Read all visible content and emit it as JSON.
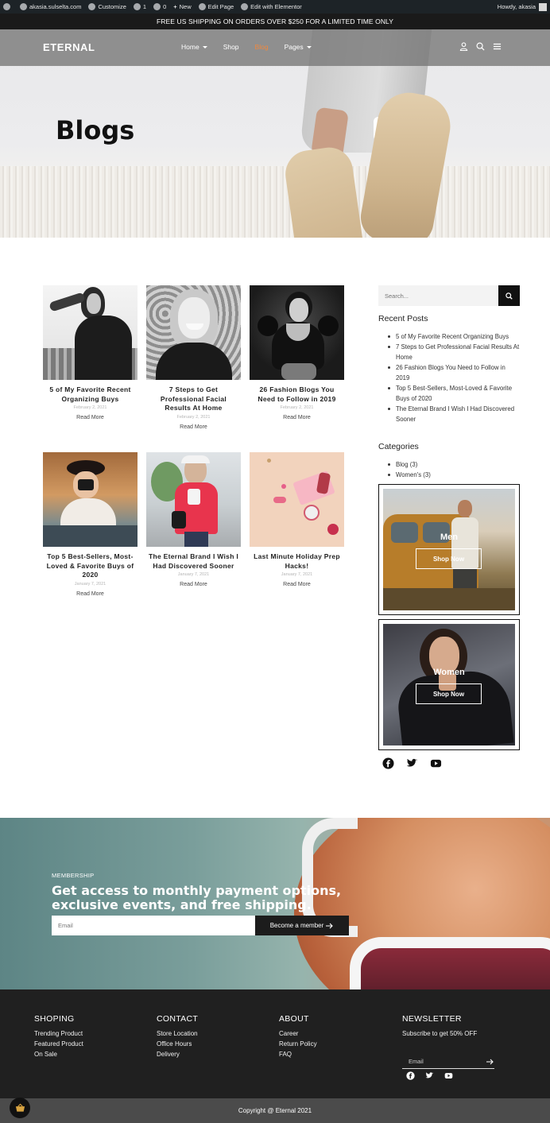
{
  "admin_bar": {
    "site": "akasia.sulselta.com",
    "customize": "Customize",
    "updates": "1",
    "comments": "0",
    "new": "New",
    "edit_page": "Edit Page",
    "elementor": "Edit with Elementor",
    "howdy": "Howdy, akasia"
  },
  "promo_banner": "FREE US SHIPPING ON ORDERS OVER $250 FOR A LIMITED TIME ONLY",
  "header": {
    "logo": "ETERNAL",
    "menu": [
      {
        "label": "Home",
        "has_dropdown": true
      },
      {
        "label": "Shop",
        "has_dropdown": false
      },
      {
        "label": "Blog",
        "active": true,
        "has_dropdown": false
      },
      {
        "label": "Pages",
        "has_dropdown": true
      }
    ],
    "icons": [
      "user-icon",
      "search-icon",
      "hamburger-menu-icon"
    ],
    "active_color": "#f0883e"
  },
  "hero": {
    "title": "Blogs"
  },
  "posts": [
    {
      "title": "5 of My Favorite Recent Organizing Buys",
      "date": "February 2, 2021",
      "read_more": "Read More"
    },
    {
      "title": "7 Steps to Get Professional Facial Results At Home",
      "date": "February 2, 2021",
      "read_more": "Read More"
    },
    {
      "title": "26 Fashion Blogs You Need to Follow in 2019",
      "date": "February 2, 2021",
      "read_more": "Read More"
    },
    {
      "title": "Top 5 Best-Sellers, Most-Loved & Favorite Buys of 2020",
      "date": "January 7, 2021",
      "read_more": "Read More"
    },
    {
      "title": "The Eternal Brand I Wish I Had Discovered Sooner",
      "date": "January 7, 2021",
      "read_more": "Read More"
    },
    {
      "title": "Last Minute Holiday Prep Hacks!",
      "date": "January 7, 2021",
      "read_more": "Read More"
    }
  ],
  "sidebar": {
    "search_placeholder": "Search...",
    "recent_posts_title": "Recent Posts",
    "recent_posts": [
      "5 of My Favorite Recent Organizing Buys",
      "7 Steps to Get Professional Facial Results At Home",
      "26 Fashion Blogs You Need to Follow in 2019",
      "Top 5 Best-Sellers, Most-Loved & Favorite Buys of 2020",
      "The Eternal Brand I Wish I Had Discovered Sooner"
    ],
    "categories_title": "Categories",
    "categories": [
      "Blog (3)",
      "Women's (3)"
    ],
    "promos": [
      {
        "label": "Men",
        "button": "Shop Now"
      },
      {
        "label": "Women",
        "button": "Shop Now"
      }
    ],
    "social": [
      "facebook-icon",
      "twitter-icon",
      "youtube-icon"
    ]
  },
  "membership": {
    "kicker": "MEMBERSHIP",
    "headline": "Get access to monthly payment options, exclusive events, and free shipping.",
    "email_placeholder": "Email",
    "button": "Become a member"
  },
  "footer": {
    "columns": [
      {
        "title": "SHOPING",
        "links": [
          "Trending Product",
          "Featured Product",
          "On Sale"
        ]
      },
      {
        "title": "CONTACT",
        "links": [
          "Store Location",
          "Office Hours",
          "Delivery"
        ]
      },
      {
        "title": "ABOUT",
        "links": [
          "Career",
          "Return Policy",
          "FAQ"
        ]
      }
    ],
    "newsletter": {
      "title": "NEWSLETTER",
      "subtitle": "Subscribe to get 50% OFF",
      "email_placeholder": "Email"
    },
    "social": [
      "facebook-icon",
      "twitter-icon",
      "youtube-icon"
    ],
    "copyright": "Copyright @ Eternal 2021"
  }
}
